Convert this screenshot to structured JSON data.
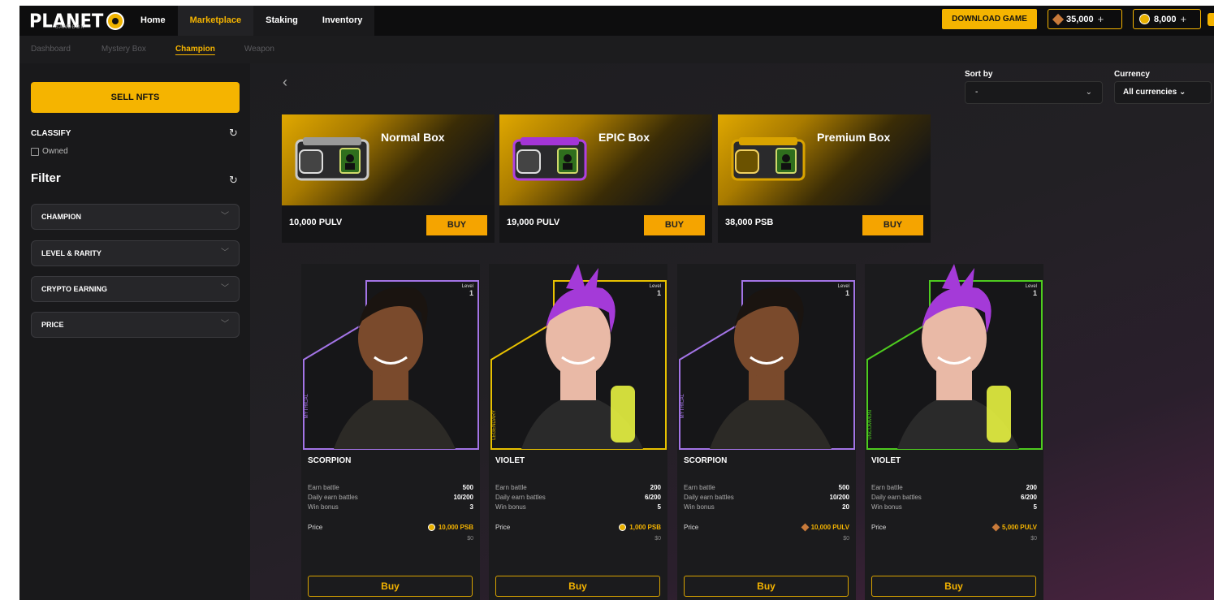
{
  "brand": {
    "logo_text": "PLANET",
    "logo_sub": "SANDBOX"
  },
  "nav": [
    {
      "label": "Home"
    },
    {
      "label": "Marketplace"
    },
    {
      "label": "Staking"
    },
    {
      "label": "Inventory"
    }
  ],
  "header": {
    "download_label": "DOWNLOAD GAME",
    "balance_1": "35,000",
    "balance_2": "8,000",
    "plus": "+"
  },
  "subnav": [
    {
      "label": "Dashboard"
    },
    {
      "label": "Mystery Box"
    },
    {
      "label": "Champion"
    },
    {
      "label": "Weapon"
    }
  ],
  "sidebar": {
    "sell_label": "SELL NFTS",
    "classify_title": "CLASSIFY",
    "owned_label": "Owned",
    "filter_title": "Filter",
    "filters": [
      {
        "label": "CHAMPION"
      },
      {
        "label": "LEVEL & RARITY"
      },
      {
        "label": "CRYPTO EARNING"
      },
      {
        "label": "PRICE"
      }
    ]
  },
  "controls": {
    "sort_label": "Sort by",
    "sort_value": "-",
    "currency_label": "Currency",
    "currency_value": "All currencies"
  },
  "boxes": [
    {
      "name": "Normal Box",
      "price": "10,000 PULV",
      "buy": "BUY",
      "accent": "#9a9a9a"
    },
    {
      "name": "EPIC Box",
      "price": "19,000 PULV",
      "buy": "BUY",
      "accent": "#a335d6"
    },
    {
      "name": "Premium Box",
      "price": "38,000 PSB",
      "buy": "BUY",
      "accent": "#d9a300"
    }
  ],
  "champions": [
    {
      "name": "SCORPION",
      "rarity": "MYTHICAL",
      "frame": "#a374e6",
      "level_label": "Level",
      "level": "1",
      "earn_battle_label": "Earn battle",
      "earn_battle": "500",
      "daily_label": "Daily earn battles",
      "daily": "10/200",
      "win_label": "Win bonus",
      "win": "3",
      "price_label": "Price",
      "price": "10,000 PSB",
      "price_icon": "coin",
      "usd": "$0",
      "buy": "Buy"
    },
    {
      "name": "VIOLET",
      "rarity": "LEGENDARY",
      "frame": "#e8c100",
      "level_label": "Level",
      "level": "1",
      "earn_battle_label": "Earn battle",
      "earn_battle": "200",
      "daily_label": "Daily earn battles",
      "daily": "6/200",
      "win_label": "Win bonus",
      "win": "5",
      "price_label": "Price",
      "price": "1,000 PSB",
      "price_icon": "coin",
      "usd": "$0",
      "buy": "Buy"
    },
    {
      "name": "SCORPION",
      "rarity": "MYTHICAL",
      "frame": "#a374e6",
      "level_label": "Level",
      "level": "1",
      "earn_battle_label": "Earn battle",
      "earn_battle": "500",
      "daily_label": "Daily earn battles",
      "daily": "10/200",
      "win_label": "Win bonus",
      "win": "20",
      "price_label": "Price",
      "price": "10,000 PULV",
      "price_icon": "diamond",
      "usd": "$0",
      "buy": "Buy"
    },
    {
      "name": "VIOLET",
      "rarity": "UNCOMMON",
      "frame": "#4ecb1f",
      "level_label": "Level",
      "level": "1",
      "earn_battle_label": "Earn battle",
      "earn_battle": "200",
      "daily_label": "Daily earn battles",
      "daily": "6/200",
      "win_label": "Win bonus",
      "win": "5",
      "price_label": "Price",
      "price": "5,000 PULV",
      "price_icon": "diamond",
      "usd": "$0",
      "buy": "Buy"
    }
  ]
}
